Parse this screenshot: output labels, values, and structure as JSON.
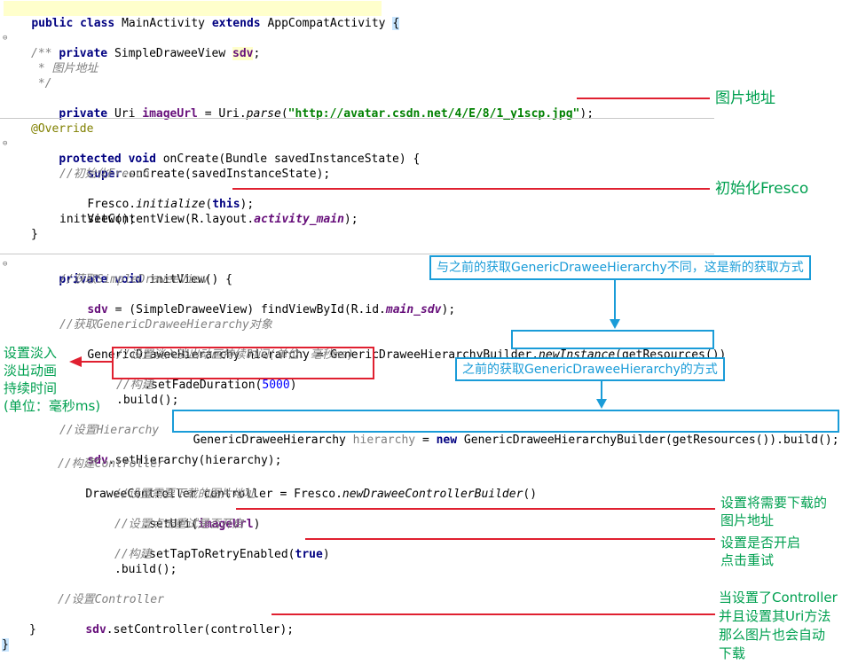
{
  "code": {
    "l1_public": "public",
    "l1_class": "class",
    "l1_name": "MainActivity",
    "l1_extends": "extends",
    "l1_parent": "AppCompatActivity",
    "l1_brace": "{",
    "l2_private": "private",
    "l2_type": "SimpleDraweeView",
    "l2_field": "sdv",
    "l3_comment1": "/**",
    "l3_comment2": " * 图片地址",
    "l3_comment3": " */",
    "l4_private": "private",
    "l4_type": "Uri",
    "l4_field": "imageUrl",
    "l4_eq": " = Uri.",
    "l4_parse": "parse",
    "l4_url": "\"http://avatar.csdn.net/4/E/8/1_y1scp.jpg\"",
    "l4_end": ");",
    "l5_anno": "@Override",
    "l6_protected": "protected",
    "l6_void": "void",
    "l6_sig": "onCreate(Bundle savedInstanceState) {",
    "l7_super": "super",
    "l7_rest": ".onCreate(savedInstanceState);",
    "l8_comment": "//初始化Fresco",
    "l9_fresco": "Fresco.",
    "l9_init": "initialize",
    "l9_paren": "(",
    "l9_this": "this",
    "l9_end": ");",
    "l10_a": "setContentView(R.layout.",
    "l10_b": "activity_main",
    "l10_c": ");",
    "l11": "initView();",
    "l12": "}",
    "l13_private": "private",
    "l13_void": "void",
    "l13_sig": "initView() {",
    "l14_comment": "//获取SimpleDraweeView",
    "l15_field": "sdv",
    "l15_a": " = (SimpleDraweeView) findViewById(R.id.",
    "l15_b": "main_sdv",
    "l15_c": ");",
    "l16_comment": "//获取GenericDraweeHierarchy对象",
    "l17_a": "GenericDraweeHierarchy hierarchy = GenericDraweeHierarchyBuilder",
    "l17_b": ".",
    "l17_c": "newInstance",
    "l17_d": "(getResources())",
    "l18_comment": "//设置淡入淡出动画持续时间(单位：毫秒ms)",
    "l19_a": ".setFadeDuration(",
    "l19_num": "5000",
    "l19_c": ")",
    "l20_comment": "//构建",
    "l21": ".build();",
    "l22_comment": "//设置Hierarchy",
    "l23_field": "sdv",
    "l23_rest": ".setHierarchy(hierarchy);",
    "l24_comment": "//构建Controller",
    "l25_a": "DraweeController controller = Fresco.",
    "l25_b": "newDraweeControllerBuilder",
    "l25_c": "()",
    "l26_comment": "//设置需要下载的图片地址",
    "l27_a": ".setUri(",
    "l27_field": "imageUrl",
    "l27_c": ")",
    "l28_comment": "//设置点击重试是否开启",
    "l29_a": ".setTapToRetryEnabled(",
    "l29_true": "true",
    "l29_c": ")",
    "l30_comment": "//构建",
    "l31": ".build();",
    "l32_comment": "//设置Controller",
    "l33_field": "sdv",
    "l33_rest": ".setController(controller);",
    "l34": "}",
    "l35": "}"
  },
  "inline_code": {
    "a": "GenericDraweeHierarchy ",
    "b": "hierarchy",
    "c": " = ",
    "d": "new",
    "e": " GenericDraweeHierarchyBuilder(getResources()).build();"
  },
  "notes": {
    "url": "图片地址",
    "init": "初始化Fresco",
    "fade": "设置淡入\n淡出动画\n持续时间\n(单位：毫秒ms)",
    "seturi": "设置将需要下载的\n图片地址",
    "retry": "设置是否开启\n点击重试",
    "controller": "当设置了Controller\n并且设置其Uri方法\n那么图片也会自动\n下载"
  },
  "callouts": {
    "new_way": "与之前的获取GenericDraweeHierarchy不同，这是新的获取方式",
    "old_way": "之前的获取GenericDraweeHierarchy的方式"
  },
  "colors": {
    "red": "#e02030",
    "blue": "#1a9cd8",
    "green": "#00a050"
  }
}
